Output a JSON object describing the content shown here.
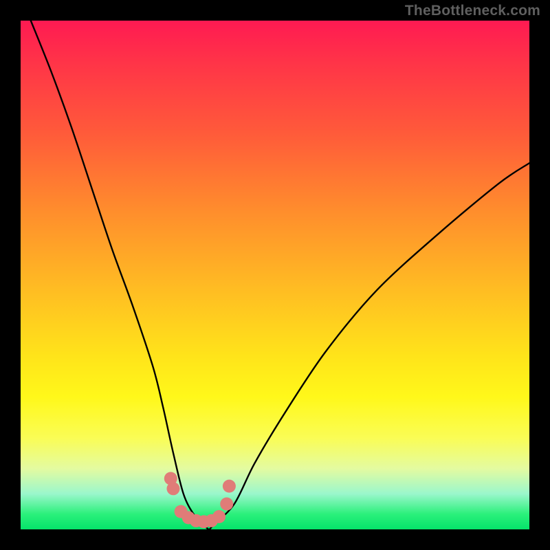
{
  "attribution": "TheBottleneck.com",
  "chart_data": {
    "type": "line",
    "title": "",
    "xlabel": "",
    "ylabel": "",
    "xlim": [
      0,
      100
    ],
    "ylim": [
      0,
      100
    ],
    "series": [
      {
        "name": "bottleneck-curve",
        "x": [
          2,
          6,
          10,
          14,
          18,
          22,
          26,
          28,
          30,
          32,
          34,
          36,
          37,
          38,
          42,
          46,
          52,
          60,
          70,
          82,
          94,
          100
        ],
        "values": [
          100,
          90,
          79,
          67,
          55,
          44,
          32,
          24,
          15,
          7,
          3,
          1,
          0,
          1,
          5,
          13,
          23,
          35,
          47,
          58,
          68,
          72
        ]
      }
    ],
    "marker_points": {
      "name": "highlight-points",
      "x": [
        29.5,
        30.0,
        31.5,
        33.0,
        34.5,
        36.0,
        37.5,
        39.0,
        40.5,
        41.0
      ],
      "values": [
        10.0,
        8.0,
        3.5,
        2.3,
        1.7,
        1.5,
        1.7,
        2.5,
        5.0,
        8.5
      ]
    },
    "colors": {
      "curve": "#000000",
      "markers": "#e07c78",
      "gradient_top": "#ff1a52",
      "gradient_bottom": "#05e36a"
    }
  }
}
